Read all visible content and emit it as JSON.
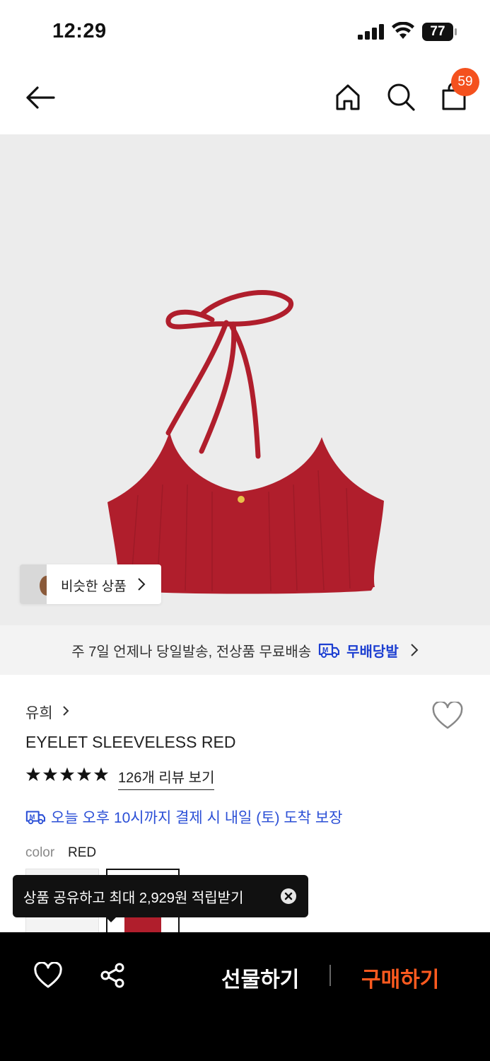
{
  "status_bar": {
    "time": "12:29",
    "battery": "77"
  },
  "header": {
    "cart_count": "59"
  },
  "hero": {
    "similar_label": "비슷한 상품"
  },
  "banner": {
    "text": "주 7일 언제나 당일발송, 전상품 무료배송",
    "brand": "무배당발"
  },
  "product": {
    "brand": "유희",
    "name": "EYELET SLEEVELESS RED",
    "rating_stars": 5,
    "review_link": "126개 리뷰 보기",
    "delivery": "오늘 오후 10시까지 결제 시 내일 (토) 도착 보장",
    "color_label": "color",
    "color_value": "RED",
    "accent_color": "#b01e2c"
  },
  "toast": {
    "text": "상품 공유하고 최대 2,929원 적립받기"
  },
  "bottom": {
    "gift_label": "선물하기",
    "buy_label": "구매하기",
    "buy_color": "#ff5a1f"
  }
}
